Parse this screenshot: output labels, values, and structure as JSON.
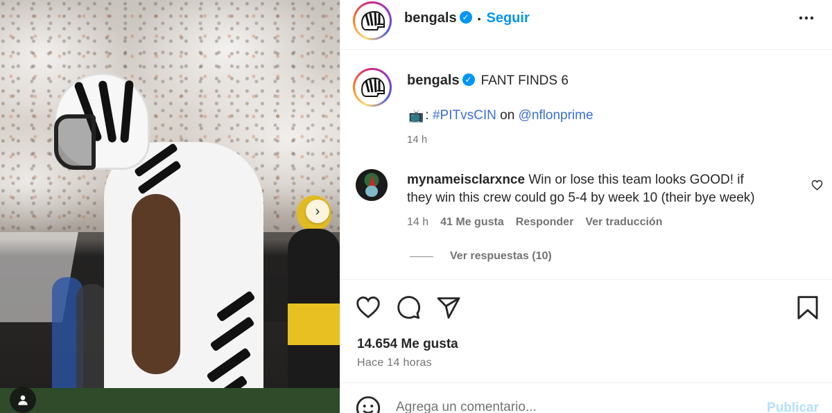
{
  "post": {
    "username": "bengals",
    "follow_label": "Seguir",
    "more_icon": "more-options-icon",
    "caption": {
      "text": "FANT FINDS 6",
      "line2_prefix": ":",
      "hashtag": "#PITvsCIN",
      "connector": "on",
      "mention": "@nflonprime",
      "time": "14 h"
    },
    "comment": {
      "username": "mynameisclarxnce",
      "text": "Win or lose this team looks GOOD! if they win this crew could go 5-4 by week 10 (their bye week)",
      "time": "14 h",
      "likes": "41 Me gusta",
      "reply_label": "Responder",
      "translate_label": "Ver traducción",
      "view_replies": "Ver respuestas (10)"
    },
    "likes_count": "14.654 Me gusta",
    "posted_ago": "Hace 14 horas",
    "add_comment": {
      "placeholder": "Agrega un comentario...",
      "publish_label": "Publicar"
    }
  },
  "colors": {
    "accent": "#0095f6",
    "muted": "#737373",
    "publish_disabled": "#b2dffc"
  }
}
